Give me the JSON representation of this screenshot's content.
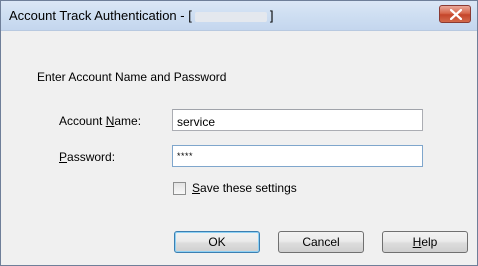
{
  "window": {
    "title_prefix": "Account Track Authentication - [",
    "title_suffix": "]"
  },
  "dialog": {
    "instruction": "Enter Account Name and Password",
    "account_label_pre": "Account ",
    "account_label_key": "N",
    "account_label_post": "ame:",
    "account_value": "service",
    "password_label_key": "P",
    "password_label_post": "assword:",
    "password_value": "****",
    "save_key": "S",
    "save_label_post": "ave these settings",
    "save_checked": false
  },
  "buttons": {
    "ok": "OK",
    "cancel": "Cancel",
    "help_key": "H",
    "help_post": "elp"
  },
  "icons": {
    "close": "close-icon"
  },
  "colors": {
    "close_button": "#c5452b",
    "title_bar": "#cfdff2",
    "dialog_background": "#f0f0f0"
  }
}
